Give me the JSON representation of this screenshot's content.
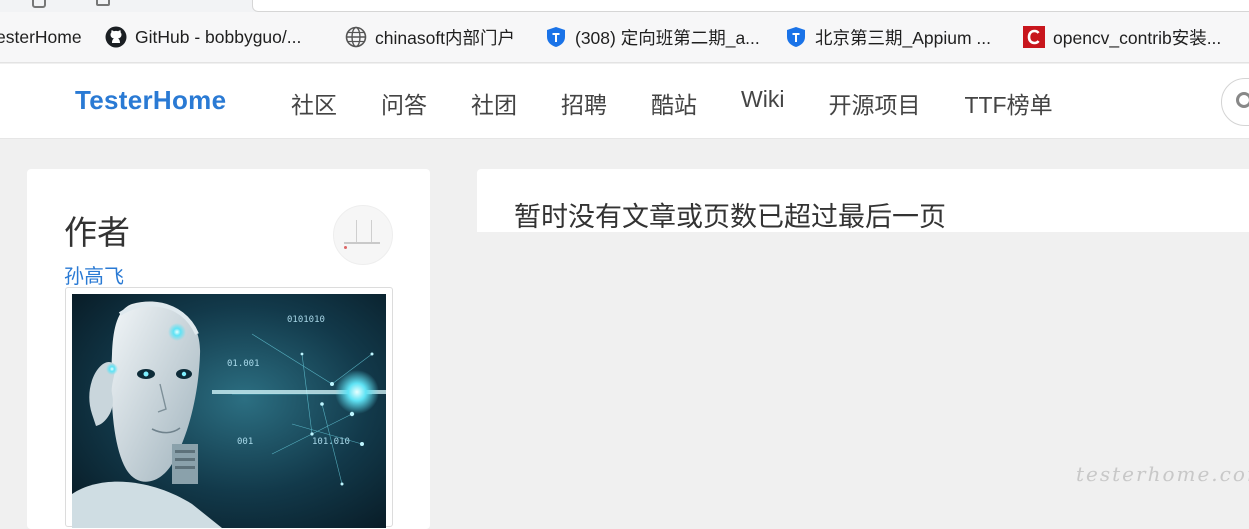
{
  "bookmarks": [
    {
      "label": "esterHome",
      "icon": "testerhome-favicon-icon"
    },
    {
      "label": "GitHub - bobbyguo/...",
      "icon": "github-icon"
    },
    {
      "label": "chinasoft内部门户",
      "icon": "globe-icon"
    },
    {
      "label": "(308) 定向班第二期_a...",
      "icon": "shield-icon"
    },
    {
      "label": "北京第三期_Appium ...",
      "icon": "shield-icon"
    },
    {
      "label": "opencv_contrib安装...",
      "icon": "csdn-icon"
    }
  ],
  "navbar": {
    "brand": "TesterHome",
    "items": [
      "社区",
      "问答",
      "社团",
      "招聘",
      "酷站",
      "Wiki",
      "开源项目",
      "TTF榜单"
    ],
    "search_icon": "search-icon"
  },
  "sidebar": {
    "title": "作者",
    "author": "孙高飞",
    "image": "robot-ai-illustration"
  },
  "main": {
    "empty_message": "暂时没有文章或页数已超过最后一页"
  },
  "watermark": "testerhome.com",
  "colors": {
    "brand": "#2a7ad4",
    "page_bg": "#f0f0f0",
    "card_bg": "#ffffff",
    "shield_blue": "#1a73e8",
    "csdn_red": "#c8161d"
  }
}
